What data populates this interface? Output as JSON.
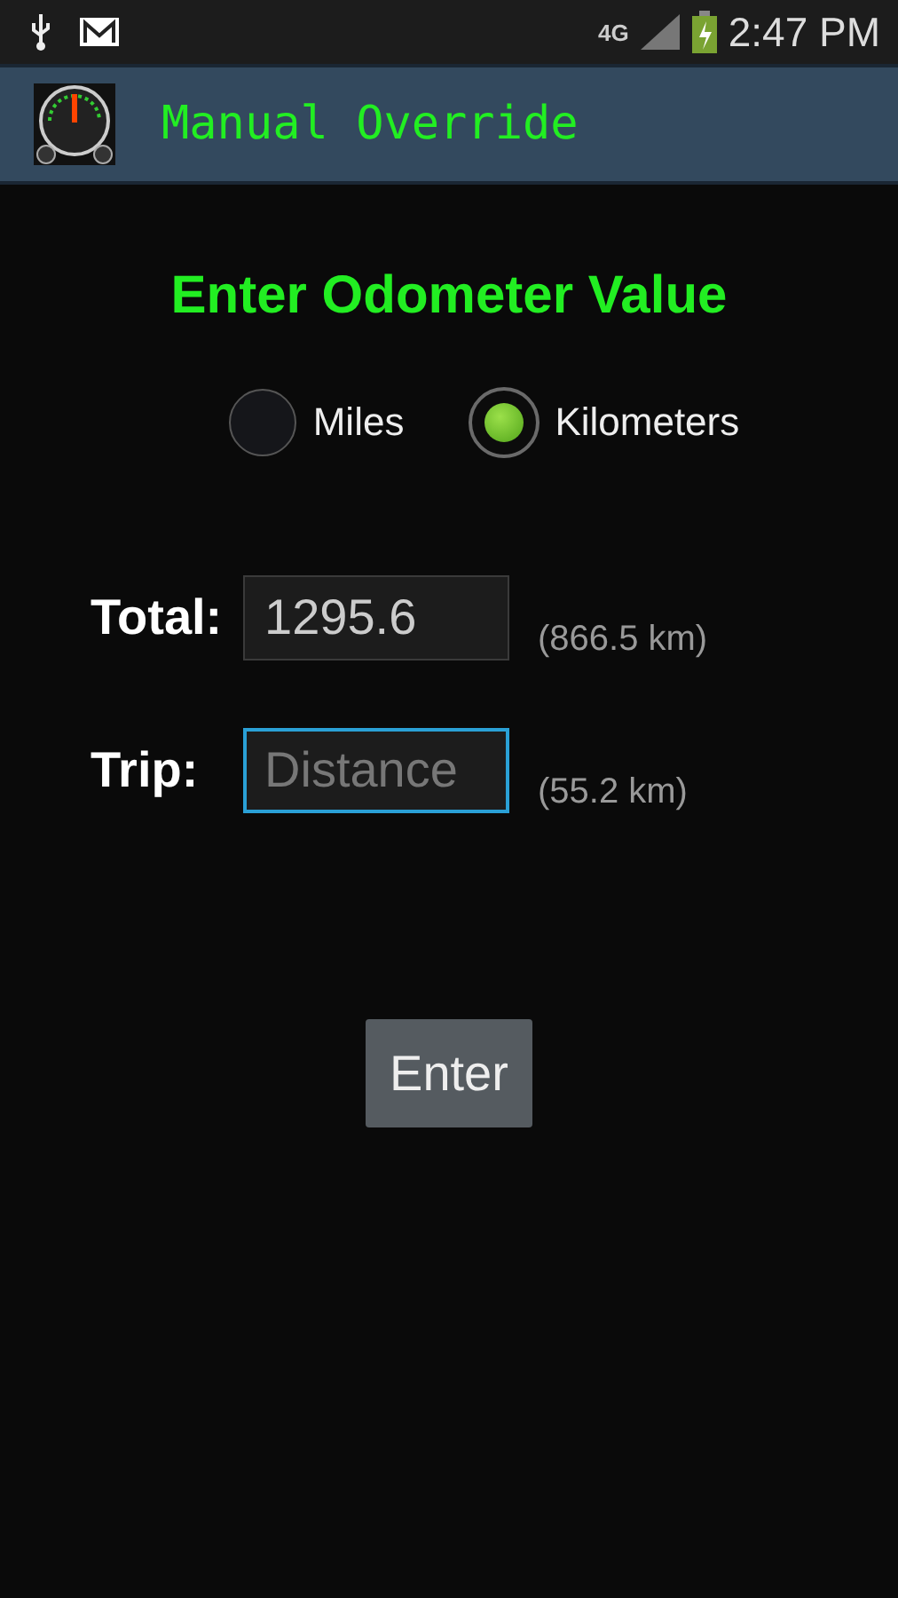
{
  "status_bar": {
    "network": "4G",
    "time": "2:47 PM"
  },
  "app_bar": {
    "title": "Manual Override"
  },
  "heading": "Enter Odometer Value",
  "units": [
    {
      "label": "Miles",
      "selected": false
    },
    {
      "label": "Kilometers",
      "selected": true
    }
  ],
  "fields": [
    {
      "label": "Total:",
      "value": "1295.6",
      "note": "(866.5 km)",
      "focused": false
    },
    {
      "label": "Trip:",
      "placeholder": "Distance",
      "note": "(55.2 km)",
      "focused": true
    }
  ],
  "button": "Enter"
}
